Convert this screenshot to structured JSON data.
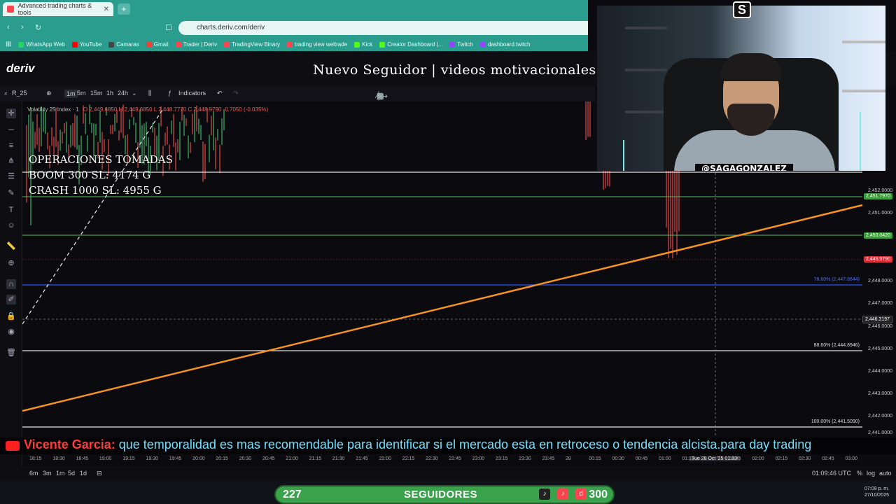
{
  "browser": {
    "tab_title": "Advanced trading charts & tools",
    "url": "charts.deriv.com/deriv",
    "bookmarks": [
      "WhatsApp Web",
      "YouTube",
      "Camaras",
      "Gmail",
      "Trader | Deriv",
      "TradingView Binary",
      "trading view weltrade",
      "Kick",
      "Creator Dashboard |...",
      "Twitch",
      "dashboard.twitch"
    ]
  },
  "header": {
    "logo": "deriv",
    "overlay_title": "Nuevo Seguidor | videos motivacionales"
  },
  "toolbar": {
    "symbol": "R_25",
    "timeframes": [
      "1m",
      "5m",
      "15m",
      "1h",
      "24h"
    ],
    "active_timeframe": "1m",
    "indicators_label": "Indicators"
  },
  "chart": {
    "legend_name": "Volatility 25 Index · 1",
    "legend_ohlc": "O 2,449.6850  H 2,449.6850  L 2,448.7770  C 2,448.9790  -0.7050 (-0.035%)",
    "operations": [
      "OPERACIONES TOMADAS",
      "BOOM 300 SL: 4174 G",
      "CRASH 1000 SL: 4955 G"
    ],
    "price_labels": [
      "2,452.0000",
      "2,451.0000",
      "2,448.0000",
      "2,447.0000",
      "2,446.0000",
      "2,445.0000",
      "2,444.0000",
      "2,443.0000",
      "2,442.0000",
      "2,441.0000"
    ],
    "tag_green_1": "2,451.7970",
    "tag_green_2": "2,450.0420",
    "tag_red": "2,448.9790",
    "tag_cursor": "2,446.3197",
    "fib_786": "78.60% (2,447.8644)",
    "fib_886": "88.60% (2,444.8946)",
    "fib_100": "100.00% (2,441.5090)",
    "crosshair_time": "Tue 28 Oct '25  01:33",
    "colors": {
      "accent_orange": "#f7931e",
      "fib_blue": "#2b4bd6",
      "green_line": "#5cb85c",
      "red_tag": "#e0303a"
    }
  },
  "time_axis": [
    "18:15",
    "18:30",
    "18:45",
    "19:00",
    "19:15",
    "19:30",
    "19:45",
    "20:00",
    "20:15",
    "20:30",
    "20:45",
    "21:00",
    "21:15",
    "21:30",
    "21:45",
    "22:00",
    "22:15",
    "22:30",
    "22:45",
    "23:00",
    "23:15",
    "23:30",
    "23:45",
    "28",
    "00:15",
    "00:30",
    "00:45",
    "01:00",
    "01:15",
    "01:45",
    "02:00",
    "02:15",
    "02:30",
    "02:45",
    "03:00"
  ],
  "bottom": {
    "ranges": [
      "6m",
      "3m",
      "1m",
      "5d",
      "1d"
    ],
    "clock": "01:09:46 UTC",
    "percent": "%",
    "log": "log",
    "auto": "auto"
  },
  "marquee": {
    "user": "Vicente Garcia:",
    "message": " que temporalidad es mas recomendable para identificar si el mercado esta en retroceso o tendencia alcista.para day trading"
  },
  "stream": {
    "handle": "@SAGAGONZALEZ",
    "followers_left": "227",
    "followers_label": "SEGUIDORES",
    "followers_right": "300"
  },
  "taskbar": {
    "time": "07:09 p. m.",
    "date": "27/10/2025"
  }
}
